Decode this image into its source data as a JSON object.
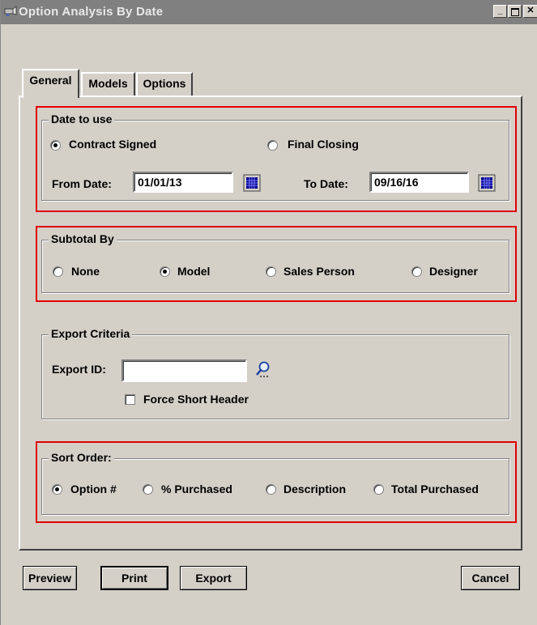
{
  "window": {
    "title": "Option Analysis By Date"
  },
  "tabs": [
    {
      "label": "General",
      "active": true
    },
    {
      "label": "Models",
      "active": false
    },
    {
      "label": "Options",
      "active": false
    }
  ],
  "date_group": {
    "legend": "Date to use",
    "radio_contract": "Contract Signed",
    "radio_final": "Final Closing",
    "selected": "Contract Signed",
    "from_label": "From Date:",
    "from_value": "01/01/13",
    "to_label": "To Date:",
    "to_value": "09/16/16"
  },
  "subtotal_group": {
    "legend": "Subtotal By",
    "options": [
      "None",
      "Model",
      "Sales Person",
      "Designer"
    ],
    "selected": "Model"
  },
  "export_group": {
    "legend": "Export Criteria",
    "id_label": "Export ID:",
    "id_value": "",
    "force_short_header": "Force Short Header",
    "force_short_header_checked": false
  },
  "sort_group": {
    "legend": "Sort Order:",
    "options": [
      "Option #",
      "% Purchased",
      "Description",
      "Total Purchased"
    ],
    "selected": "Option #"
  },
  "buttons": {
    "preview": "Preview",
    "print": "Print",
    "export": "Export",
    "cancel": "Cancel"
  },
  "colors": {
    "titlebar": "#808080",
    "window_face": "#d4d0c8",
    "highlight_box": "#e00000",
    "calendar_blue": "#00008b"
  }
}
